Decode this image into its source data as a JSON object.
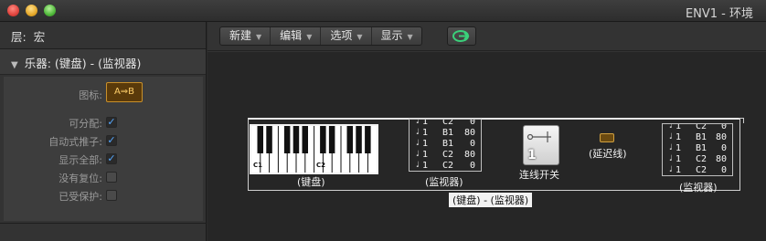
{
  "window": {
    "title": "ENV1 - 环境"
  },
  "inspector": {
    "layer_label": "层:",
    "layer_value": "宏",
    "instrument_title": "乐器: (键盘) - (监视器)",
    "icon_label": "图标:",
    "icon_text": "A⇒B",
    "properties": [
      {
        "label": "可分配:",
        "checked": true
      },
      {
        "label": "自动式推子:",
        "checked": true
      },
      {
        "label": "显示全部:",
        "checked": true
      },
      {
        "label": "没有复位:",
        "checked": false
      },
      {
        "label": "已受保护:",
        "checked": false
      }
    ]
  },
  "toolbar": {
    "menus": [
      "新建",
      "编辑",
      "选项",
      "显示"
    ]
  },
  "environment": {
    "keyboard_label": "(键盘)",
    "keyboard_keys": [
      "C1",
      "C2"
    ],
    "monitor1": {
      "label": "(监视器)",
      "lines": [
        [
          "1",
          "C2",
          "0"
        ],
        [
          "1",
          "B1",
          "80"
        ],
        [
          "1",
          "B1",
          "0"
        ],
        [
          "1",
          "C2",
          "80"
        ],
        [
          "1",
          "C2",
          "0"
        ]
      ]
    },
    "switch": {
      "label": "连线开关",
      "value": "1"
    },
    "delay": {
      "label": "(延迟线)"
    },
    "monitor2": {
      "label": "(监视器)",
      "lines": [
        [
          "1",
          "C2",
          "0"
        ],
        [
          "1",
          "B1",
          "80"
        ],
        [
          "1",
          "B1",
          "0"
        ],
        [
          "1",
          "C2",
          "80"
        ],
        [
          "1",
          "C2",
          "0"
        ]
      ]
    },
    "group_label": "(键盘) - (监视器)"
  },
  "colors": {
    "checkbox_check": "#55a8ff",
    "icon_accent": "#c9902a",
    "link_icon": "#3ad07a"
  },
  "icons": {
    "link": "link-arrow-icon",
    "check": "checkmark-icon"
  }
}
